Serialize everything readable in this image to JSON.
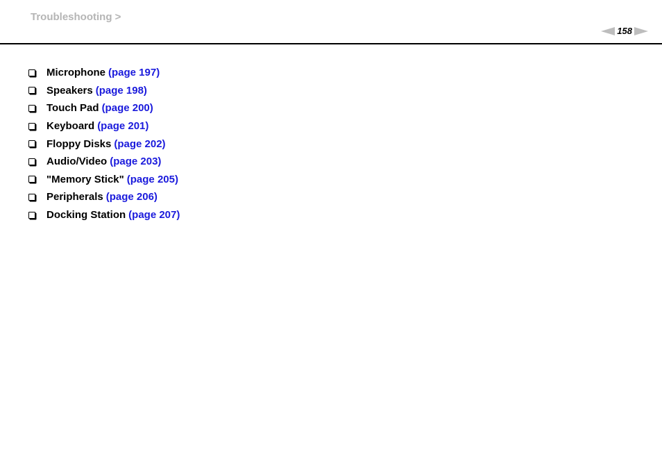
{
  "header": {
    "breadcrumb": "Troubleshooting >",
    "page_number": "158",
    "prev_icon": "prev-page-arrow",
    "next_icon": "next-page-arrow"
  },
  "items": [
    {
      "label": "Microphone",
      "link": "(page 197)"
    },
    {
      "label": "Speakers",
      "link": "(page 198)"
    },
    {
      "label": "Touch Pad",
      "link": "(page 200)"
    },
    {
      "label": "Keyboard",
      "link": "(page 201)"
    },
    {
      "label": "Floppy Disks",
      "link": "(page 202)"
    },
    {
      "label": "Audio/Video",
      "link": "(page 203)"
    },
    {
      "label": "\"Memory Stick\"",
      "link": "(page 205)"
    },
    {
      "label": "Peripherals",
      "link": "(page 206)"
    },
    {
      "label": "Docking Station",
      "link": "(page 207)"
    }
  ],
  "colors": {
    "link": "#1a1adc",
    "breadcrumb": "#b5b5b5",
    "arrow": "#bdbdbd"
  }
}
